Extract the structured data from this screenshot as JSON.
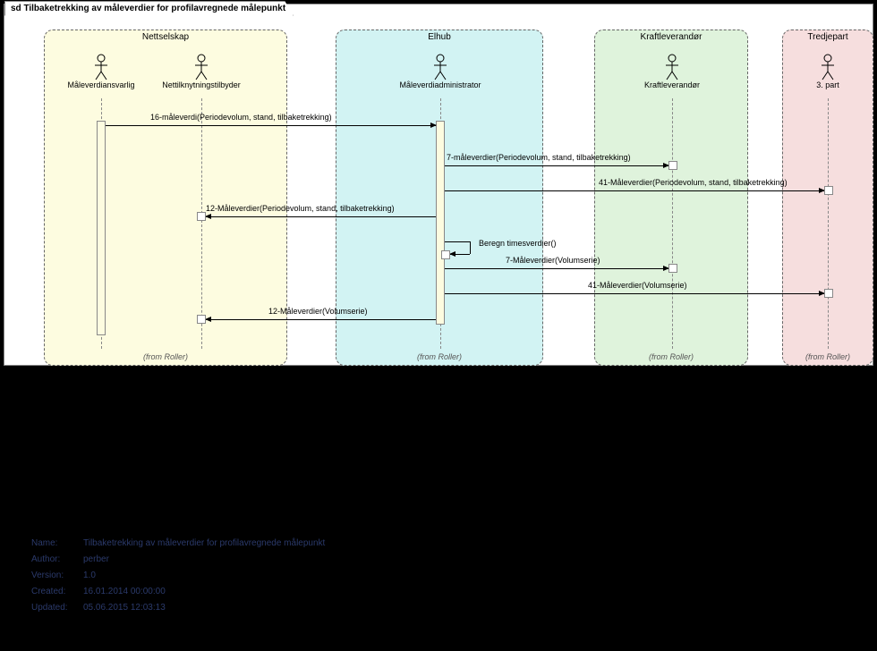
{
  "frame": {
    "title": "sd Tilbaketrekking av måleverdier for profilavregnede målepunkt"
  },
  "lanes": {
    "nettselskap": {
      "title": "Nettselskap",
      "from": "(from Roller)"
    },
    "elhub": {
      "title": "Elhub",
      "from": "(from Roller)"
    },
    "kraft": {
      "title": "Kraftleverandør",
      "from": "(from Roller)"
    },
    "tredje": {
      "title": "Tredjepart",
      "from": "(from Roller)"
    }
  },
  "actors": {
    "a1": "Måleverdiansvarlig",
    "a2": "Nettilknytningstilbyder",
    "a3": "Måleverdiadministrator",
    "a4": "Kraftleverandør",
    "a5": "3. part"
  },
  "messages": {
    "m1": "16-måleverdi(Periodevolum, stand, tilbaketrekking)",
    "m2": "7-måleverdier(Periodevolum, stand, tilbaketrekking)",
    "m3": "41-Måleverdier(Periodevolum, stand, tilbaketrekking)",
    "m4": "12-Måleverdier(Periodevolum, stand, tilbaketrekking)",
    "m5": "Beregn timesverdier()",
    "m6": "7-Måleverdier(Volumserie)",
    "m7": "41-Måleverdier(Volumserie)",
    "m8": "12-Måleverdier(Volumserie)"
  },
  "meta": {
    "name_k": "Name:",
    "name_v": "Tilbaketrekking av måleverdier for profilavregnede målepunkt",
    "author_k": "Author:",
    "author_v": "perber",
    "version_k": "Version:",
    "version_v": "1.0",
    "created_k": "Created:",
    "created_v": "16.01.2014 00:00:00",
    "updated_k": "Updated:",
    "updated_v": "05.06.2015 12:03:13"
  }
}
